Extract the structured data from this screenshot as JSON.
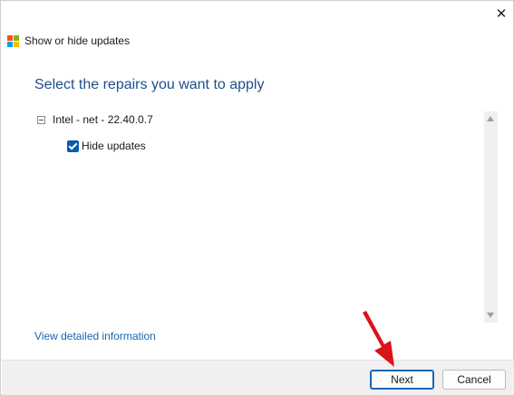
{
  "window": {
    "title": "Show or hide updates",
    "close_glyph": "✕",
    "logo_colors": [
      "#f25022",
      "#7fba00",
      "#00a4ef",
      "#ffb900"
    ]
  },
  "main": {
    "heading": "Select the repairs you want to apply",
    "tree": {
      "node_label": "Intel - net - 22.40.0.7",
      "node_expanded": true,
      "child_label": "Hide updates",
      "child_checked": true
    },
    "detail_link": "View detailed information"
  },
  "footer": {
    "next_label": "Next",
    "cancel_label": "Cancel"
  },
  "colors": {
    "heading": "#1d4f8c",
    "link": "#1766b3",
    "checkbox": "#0b5cad",
    "annotation_arrow": "#d9141b"
  }
}
